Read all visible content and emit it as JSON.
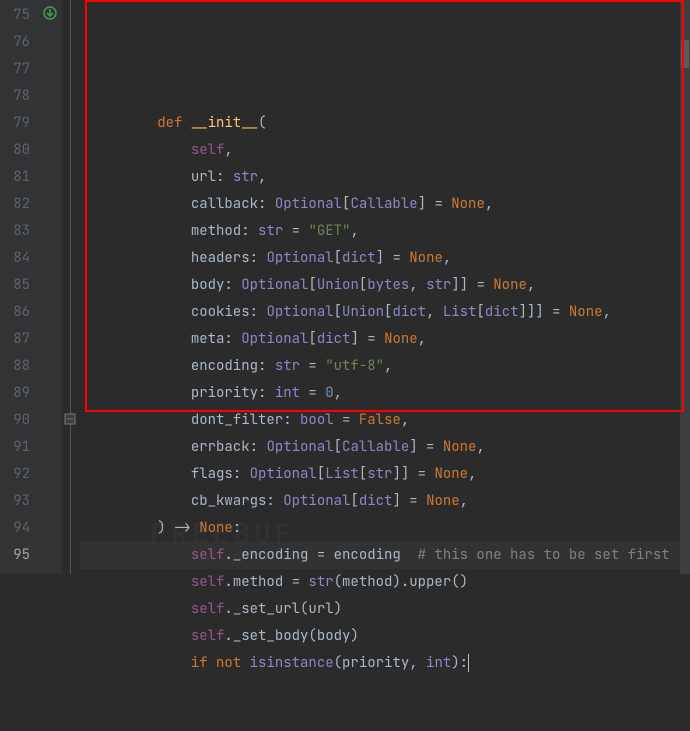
{
  "line_numbers": [
    "75",
    "76",
    "77",
    "78",
    "79",
    "80",
    "81",
    "82",
    "83",
    "84",
    "85",
    "86",
    "87",
    "88",
    "89",
    "90",
    "91",
    "92",
    "93",
    "94",
    "95"
  ],
  "current_line_index": 20,
  "watermark": "FREEBUF",
  "annotation_box": {
    "present": true
  },
  "gutter_icon": {
    "name": "override-method-icon",
    "line": 0
  },
  "fold_icon": {
    "line": 15
  },
  "tokens": [
    [
      {
        "c": "kw",
        "t": "def "
      },
      {
        "c": "fn",
        "t": "__init__"
      },
      {
        "c": "punc",
        "t": "("
      }
    ],
    [
      {
        "c": "self",
        "t": "self"
      },
      {
        "c": "punc",
        "t": ","
      }
    ],
    [
      {
        "c": "param",
        "t": "url"
      },
      {
        "c": "punc",
        "t": ": "
      },
      {
        "c": "builtin",
        "t": "str"
      },
      {
        "c": "punc",
        "t": ","
      }
    ],
    [
      {
        "c": "param",
        "t": "callback"
      },
      {
        "c": "punc",
        "t": ": "
      },
      {
        "c": "type",
        "t": "Optional"
      },
      {
        "c": "punc",
        "t": "["
      },
      {
        "c": "type",
        "t": "Callable"
      },
      {
        "c": "punc",
        "t": "] = "
      },
      {
        "c": "kw",
        "t": "None"
      },
      {
        "c": "punc",
        "t": ","
      }
    ],
    [
      {
        "c": "param",
        "t": "method"
      },
      {
        "c": "punc",
        "t": ": "
      },
      {
        "c": "builtin",
        "t": "str"
      },
      {
        "c": "punc",
        "t": " = "
      },
      {
        "c": "str",
        "t": "\"GET\""
      },
      {
        "c": "punc",
        "t": ","
      }
    ],
    [
      {
        "c": "param",
        "t": "headers"
      },
      {
        "c": "punc",
        "t": ": "
      },
      {
        "c": "type",
        "t": "Optional"
      },
      {
        "c": "punc",
        "t": "["
      },
      {
        "c": "builtin",
        "t": "dict"
      },
      {
        "c": "punc",
        "t": "] = "
      },
      {
        "c": "kw",
        "t": "None"
      },
      {
        "c": "punc",
        "t": ","
      }
    ],
    [
      {
        "c": "param",
        "t": "body"
      },
      {
        "c": "punc",
        "t": ": "
      },
      {
        "c": "type",
        "t": "Optional"
      },
      {
        "c": "punc",
        "t": "["
      },
      {
        "c": "type",
        "t": "Union"
      },
      {
        "c": "punc",
        "t": "["
      },
      {
        "c": "builtin",
        "t": "bytes"
      },
      {
        "c": "punc",
        "t": ", "
      },
      {
        "c": "builtin",
        "t": "str"
      },
      {
        "c": "punc",
        "t": "]] = "
      },
      {
        "c": "kw",
        "t": "None"
      },
      {
        "c": "punc",
        "t": ","
      }
    ],
    [
      {
        "c": "param",
        "t": "cookies"
      },
      {
        "c": "punc",
        "t": ": "
      },
      {
        "c": "type",
        "t": "Optional"
      },
      {
        "c": "punc",
        "t": "["
      },
      {
        "c": "type",
        "t": "Union"
      },
      {
        "c": "punc",
        "t": "["
      },
      {
        "c": "builtin",
        "t": "dict"
      },
      {
        "c": "punc",
        "t": ", "
      },
      {
        "c": "type",
        "t": "List"
      },
      {
        "c": "punc",
        "t": "["
      },
      {
        "c": "builtin",
        "t": "dict"
      },
      {
        "c": "punc",
        "t": "]]] = "
      },
      {
        "c": "kw",
        "t": "None"
      },
      {
        "c": "punc",
        "t": ","
      }
    ],
    [
      {
        "c": "param",
        "t": "meta"
      },
      {
        "c": "punc",
        "t": ": "
      },
      {
        "c": "type",
        "t": "Optional"
      },
      {
        "c": "punc",
        "t": "["
      },
      {
        "c": "builtin",
        "t": "dict"
      },
      {
        "c": "punc",
        "t": "] = "
      },
      {
        "c": "kw",
        "t": "None"
      },
      {
        "c": "punc",
        "t": ","
      }
    ],
    [
      {
        "c": "param",
        "t": "encoding"
      },
      {
        "c": "punc",
        "t": ": "
      },
      {
        "c": "builtin",
        "t": "str"
      },
      {
        "c": "punc",
        "t": " = "
      },
      {
        "c": "str",
        "t": "\"utf-8\""
      },
      {
        "c": "punc",
        "t": ","
      }
    ],
    [
      {
        "c": "param",
        "t": "priority"
      },
      {
        "c": "punc",
        "t": ": "
      },
      {
        "c": "builtin",
        "t": "int"
      },
      {
        "c": "punc",
        "t": " = "
      },
      {
        "c": "num",
        "t": "0"
      },
      {
        "c": "punc",
        "t": ","
      }
    ],
    [
      {
        "c": "param",
        "t": "dont_filter"
      },
      {
        "c": "punc",
        "t": ": "
      },
      {
        "c": "builtin",
        "t": "bool"
      },
      {
        "c": "punc",
        "t": " = "
      },
      {
        "c": "kw",
        "t": "False"
      },
      {
        "c": "punc",
        "t": ","
      }
    ],
    [
      {
        "c": "param",
        "t": "errback"
      },
      {
        "c": "punc",
        "t": ": "
      },
      {
        "c": "type",
        "t": "Optional"
      },
      {
        "c": "punc",
        "t": "["
      },
      {
        "c": "type",
        "t": "Callable"
      },
      {
        "c": "punc",
        "t": "] = "
      },
      {
        "c": "kw",
        "t": "None"
      },
      {
        "c": "punc",
        "t": ","
      }
    ],
    [
      {
        "c": "param",
        "t": "flags"
      },
      {
        "c": "punc",
        "t": ": "
      },
      {
        "c": "type",
        "t": "Optional"
      },
      {
        "c": "punc",
        "t": "["
      },
      {
        "c": "type",
        "t": "List"
      },
      {
        "c": "punc",
        "t": "["
      },
      {
        "c": "builtin",
        "t": "str"
      },
      {
        "c": "punc",
        "t": "]] = "
      },
      {
        "c": "kw",
        "t": "None"
      },
      {
        "c": "punc",
        "t": ","
      }
    ],
    [
      {
        "c": "param",
        "t": "cb_kwargs"
      },
      {
        "c": "punc",
        "t": ": "
      },
      {
        "c": "type",
        "t": "Optional"
      },
      {
        "c": "punc",
        "t": "["
      },
      {
        "c": "builtin",
        "t": "dict"
      },
      {
        "c": "punc",
        "t": "] = "
      },
      {
        "c": "kw",
        "t": "None"
      },
      {
        "c": "punc",
        "t": ","
      }
    ],
    [
      {
        "c": "punc",
        "t": ") -> "
      },
      {
        "c": "kw",
        "t": "None"
      },
      {
        "c": "punc",
        "t": ":"
      }
    ],
    [
      {
        "c": "self",
        "t": "self"
      },
      {
        "c": "punc",
        "t": "._encoding = encoding  "
      },
      {
        "c": "comment",
        "t": "# this one has to be set first"
      }
    ],
    [
      {
        "c": "self",
        "t": "self"
      },
      {
        "c": "punc",
        "t": ".method = "
      },
      {
        "c": "builtin",
        "t": "str"
      },
      {
        "c": "punc",
        "t": "(method).upper()"
      }
    ],
    [
      {
        "c": "self",
        "t": "self"
      },
      {
        "c": "punc",
        "t": "._set_url(url)"
      }
    ],
    [
      {
        "c": "self",
        "t": "self"
      },
      {
        "c": "punc",
        "t": "._set_body(body)"
      }
    ],
    [
      {
        "c": "kw",
        "t": "if not "
      },
      {
        "c": "builtin",
        "t": "isinstance"
      },
      {
        "c": "punc",
        "t": "(priority"
      },
      {
        "c": "punc",
        "t": ", "
      },
      {
        "c": "builtin",
        "t": "int"
      },
      {
        "c": "punc",
        "t": "):"
      }
    ]
  ],
  "indents": [
    8,
    12,
    12,
    12,
    12,
    12,
    12,
    12,
    12,
    12,
    12,
    12,
    12,
    12,
    12,
    8,
    12,
    12,
    12,
    12,
    12
  ]
}
